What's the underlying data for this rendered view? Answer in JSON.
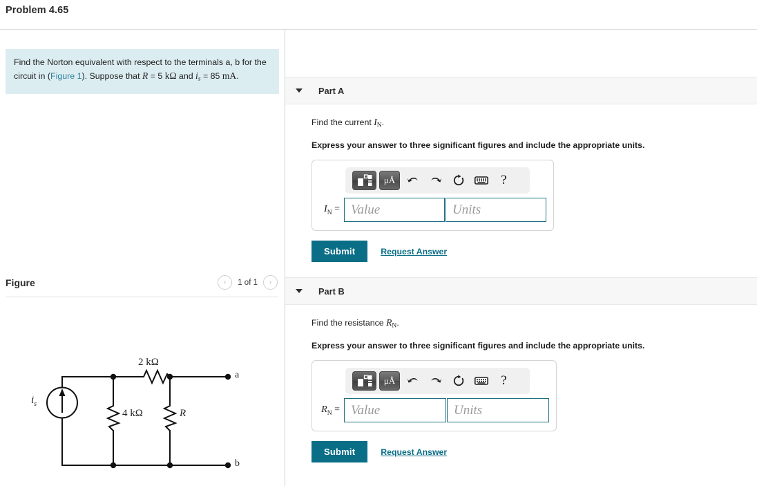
{
  "header": {
    "problem_title": "Problem 4.65"
  },
  "prompt": {
    "text_before_link": "Find the Norton equivalent with respect to the terminals a, b for the circuit in (",
    "link_label": "Figure 1",
    "text_after_link": "). Suppose that ",
    "given_r_symbol": "R",
    "given_r_eq": " = 5 ",
    "given_r_unit": "kΩ",
    "given_and": " and ",
    "given_is_symbol": "i",
    "given_is_sub": "s",
    "given_is_eq": " = 85 ",
    "given_is_unit": "mA",
    "trailing": "."
  },
  "figure_panel": {
    "title": "Figure",
    "prev_label": "‹",
    "next_label": "›",
    "counter": "1 of 1"
  },
  "circuit": {
    "source_label_sym": "i",
    "source_label_sub": "s",
    "r_top_label": "2 kΩ",
    "r_mid_label": "4 kΩ",
    "r_right_label": "R",
    "terminal_a": "a",
    "terminal_b": "b"
  },
  "parts": [
    {
      "id": "part-a",
      "label": "Part A",
      "question_prefix": "Find the current ",
      "question_symbol": "I",
      "question_sub": "N",
      "question_suffix": ".",
      "instruction": "Express your answer to three significant figures and include the appropriate units.",
      "answer_symbol": "I",
      "answer_sub": "N",
      "answer_eq": " =",
      "value_placeholder": "Value",
      "units_placeholder": "Units",
      "value_width": 146,
      "units_width": 146,
      "submit_label": "Submit",
      "request_label": "Request Answer"
    },
    {
      "id": "part-b",
      "label": "Part B",
      "question_prefix": "Find the resistance ",
      "question_symbol": "R",
      "question_sub": "N",
      "question_suffix": ".",
      "instruction": "Express your answer to three significant figures and include the appropriate units.",
      "answer_symbol": "R",
      "answer_sub": "N",
      "answer_eq": " =",
      "value_placeholder": "Value",
      "units_placeholder": "Units",
      "value_width": 148,
      "units_width": 148,
      "submit_label": "Submit",
      "request_label": "Request Answer"
    }
  ],
  "toolbar": {
    "template_icon": "math-template-icon",
    "units_label": "μÅ",
    "undo_icon": "undo-arrow-icon",
    "redo_icon": "redo-arrow-icon",
    "reset_icon": "reset-circular-arrow-icon",
    "keyboard_icon": "keyboard-icon",
    "help_label": "?"
  },
  "colors": {
    "accent_teal": "#0a6e87",
    "prompt_bg": "#dcedf1",
    "part_header_bg": "#f7f7f7",
    "input_border": "#1c6e83",
    "link_blue": "#2e7f9e"
  }
}
